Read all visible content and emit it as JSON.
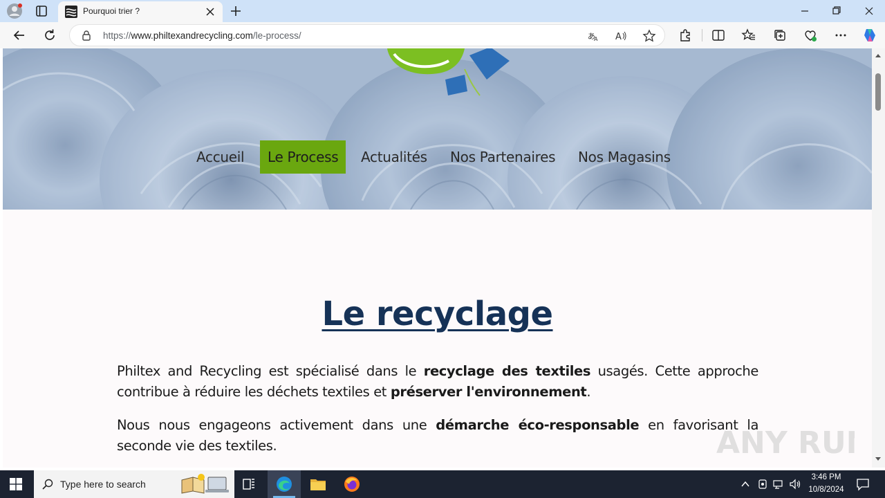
{
  "browser": {
    "tab_title": "Pourquoi trier ?",
    "url_prefix": "https://",
    "url_domain": "www.philtexandrecycling.com",
    "url_path": "/le-process/"
  },
  "nav": {
    "items": [
      {
        "label": "Accueil",
        "active": false
      },
      {
        "label": "Le Process",
        "active": true
      },
      {
        "label": "Actualités",
        "active": false
      },
      {
        "label": "Nos Partenaires",
        "active": false
      },
      {
        "label": "Nos Magasins",
        "active": false
      }
    ]
  },
  "content": {
    "heading": "Le recyclage",
    "p1_a": "Philtex and Recycling est spécialisé dans le ",
    "p1_b": "recyclage des textiles",
    "p1_c": " usagés. Cette approche contribue à réduire les déchets textiles et ",
    "p1_d": "préserver l'environnement",
    "p1_e": ".",
    "p2_a": "Nous nous engageons activement dans une ",
    "p2_b": "démarche éco-responsable",
    "p2_c": " en favorisant la seconde vie des textiles."
  },
  "taskbar": {
    "search_placeholder": "Type here to search",
    "time": "3:46 PM",
    "date": "10/8/2024"
  },
  "watermark": "ANY RUN",
  "colors": {
    "nav_active": "#6aa70f",
    "heading": "#163257",
    "tab_strip": "#cfe2f8"
  }
}
